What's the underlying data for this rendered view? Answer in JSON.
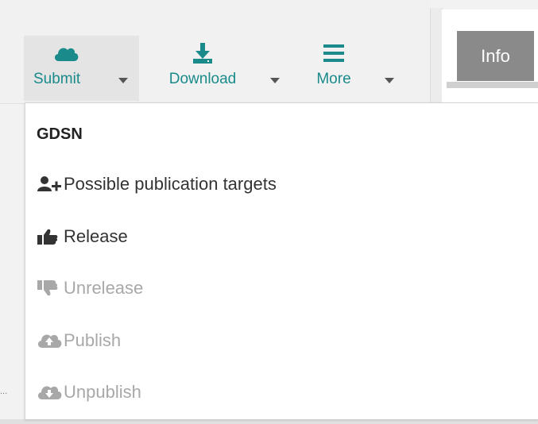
{
  "toolbar": {
    "submit_label": "Submit",
    "download_label": "Download",
    "more_label": "More"
  },
  "tabs": {
    "info_label": "Info"
  },
  "background": {
    "partial_text": "..."
  },
  "dropdown": {
    "header": "GDSN",
    "items": [
      {
        "label": "Possible publication targets",
        "icon": "user-plus-icon",
        "enabled": true
      },
      {
        "label": "Release",
        "icon": "thumbs-up-icon",
        "enabled": true
      },
      {
        "label": "Unrelease",
        "icon": "thumbs-down-icon",
        "enabled": false
      },
      {
        "label": "Publish",
        "icon": "cloud-upload-icon",
        "enabled": false
      },
      {
        "label": "Unpublish",
        "icon": "cloud-download-icon",
        "enabled": false
      }
    ]
  },
  "colors": {
    "accent": "#1a8a8a",
    "info_tab": "#8a8a8a",
    "disabled_text": "#a8a8a8",
    "text": "#333333"
  }
}
